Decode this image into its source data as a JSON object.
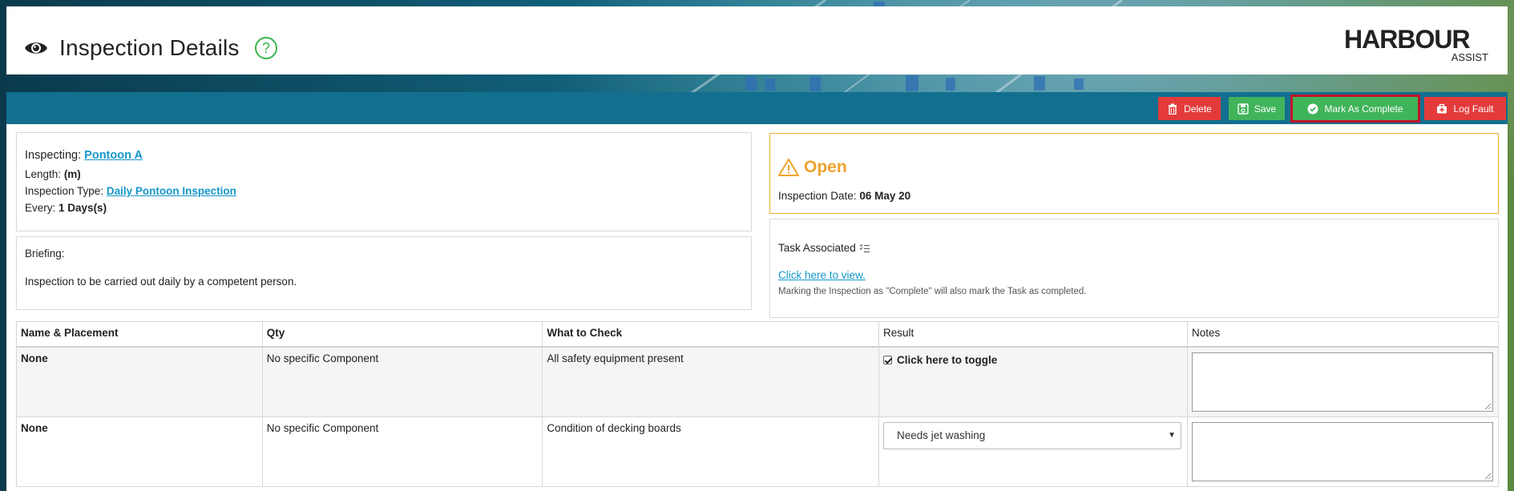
{
  "header": {
    "title": "Inspection Details",
    "logo_main": "HARBOUR",
    "logo_sub": "ASSIST"
  },
  "toolbar": {
    "delete_label": "Delete",
    "save_label": "Save",
    "complete_label": "Mark As Complete",
    "log_fault_label": "Log Fault"
  },
  "info": {
    "inspecting_label": "Inspecting:",
    "inspecting_value": "Pontoon A",
    "length_label": "Length:",
    "length_value": "(m)",
    "type_label": "Inspection Type:",
    "type_value": "Daily Pontoon Inspection",
    "every_label": "Every:",
    "every_value": "1 Days(s)"
  },
  "briefing": {
    "label": "Briefing:",
    "text": "Inspection to be carried out daily by a competent person."
  },
  "status": {
    "state": "Open",
    "date_label": "Inspection Date:",
    "date_value": "06 May 20"
  },
  "task": {
    "label": "Task Associated",
    "link": "Click here to view.",
    "note": "Marking the Inspection as \"Complete\" will also mark the Task as completed."
  },
  "table": {
    "headers": [
      "Name & Placement",
      "Qty",
      "What to Check",
      "Result",
      "Notes"
    ],
    "rows": [
      {
        "name": "None",
        "qty": "No specific Component",
        "check": "All safety equipment present",
        "result": "Click here to toggle",
        "notes": ""
      },
      {
        "name": "None",
        "qty": "No specific Component",
        "check": "Condition of decking boards",
        "result": "Needs jet washing",
        "notes": ""
      }
    ]
  },
  "colors": {
    "toolbar": "#126f8f",
    "danger": "#e33b3b",
    "success": "#40b45a",
    "warning": "#f0a22c",
    "link": "#1497c9",
    "highlight": "#c1132a"
  },
  "icons": [
    "eye-icon",
    "help-circle-icon",
    "trash-icon",
    "save-icon",
    "check-circle-icon",
    "first-aid-icon",
    "warning-icon",
    "checklist-icon",
    "chevron-down-icon"
  ]
}
